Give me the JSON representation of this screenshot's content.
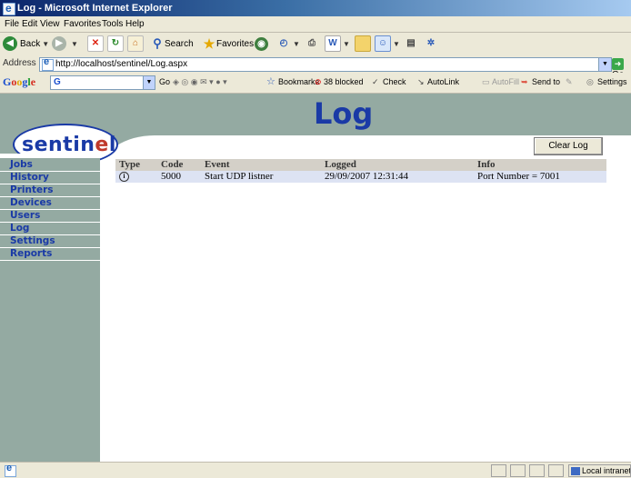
{
  "window": {
    "title": "Log - Microsoft Internet Explorer"
  },
  "menu": {
    "items": [
      "File",
      "Edit",
      "View",
      "Favorites",
      "Tools",
      "Help"
    ]
  },
  "toolbar": {
    "back": "Back",
    "search": "Search",
    "favorites": "Favorites"
  },
  "address": {
    "label": "Address",
    "url": "http://localhost/sentinel/Log.aspx",
    "go": "Go"
  },
  "google_toolbar": {
    "logo": "Google",
    "prefix": "G",
    "go": "Go",
    "bookmarks": "Bookmarks",
    "blocked": "38 blocked",
    "check": "Check",
    "autolink": "AutoLink",
    "autofill": "AutoFill",
    "sendto": "Send to",
    "settings": "Settings"
  },
  "page": {
    "logo_main": "sentin",
    "logo_accent": "e",
    "logo_end": "l",
    "title": "Log"
  },
  "sidebar": {
    "items": [
      {
        "label": "Jobs"
      },
      {
        "label": "History"
      },
      {
        "label": "Printers"
      },
      {
        "label": "Devices"
      },
      {
        "label": "Users"
      },
      {
        "label": "Log"
      },
      {
        "label": "Settings"
      },
      {
        "label": "Reports"
      }
    ]
  },
  "actions": {
    "clear_log": "Clear Log"
  },
  "log_table": {
    "headers": {
      "type": "Type",
      "code": "Code",
      "event": "Event",
      "logged": "Logged",
      "info": "Info"
    },
    "rows": [
      {
        "type_icon": "info-icon",
        "icon_glyph": "i",
        "code": "5000",
        "event": "Start UDP listner",
        "logged": "29/09/2007 12:31:44",
        "info": "Port Number = 7001"
      }
    ]
  },
  "status": {
    "zone": "Local intranet"
  }
}
